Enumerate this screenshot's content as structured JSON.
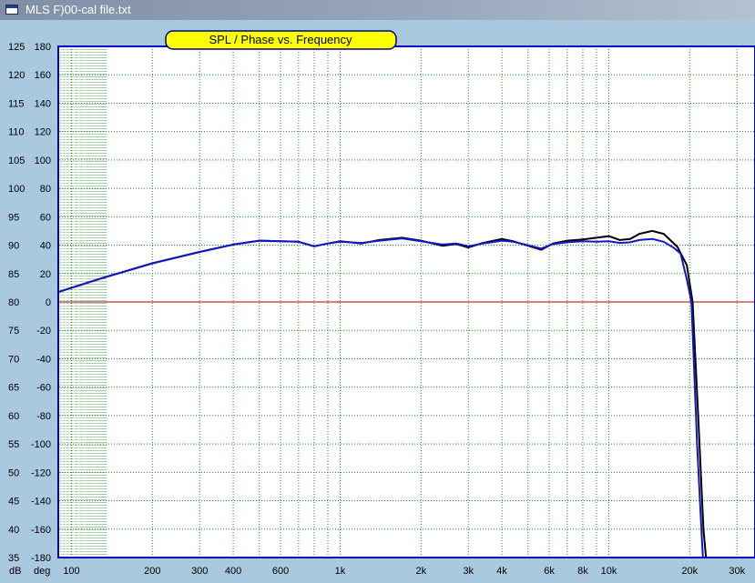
{
  "window": {
    "title": "MLS F)00-cal file.txt"
  },
  "colors": {
    "grid": "#1f8a2a",
    "zero_line": "#b00000",
    "spl_curve": "#000000",
    "phase_curve": "#1414c8",
    "background": "#a9c9de",
    "title_box": "#ffff00"
  },
  "chart_data": {
    "type": "line",
    "title": "SPL / Phase vs. Frequency",
    "x_scale": "log",
    "xlim": [
      90,
      35000
    ],
    "x_ticks": [
      {
        "value": 100,
        "label": "100"
      },
      {
        "value": 200,
        "label": "200"
      },
      {
        "value": 300,
        "label": "300"
      },
      {
        "value": 400,
        "label": "400"
      },
      {
        "value": 600,
        "label": "600"
      },
      {
        "value": 1000,
        "label": "1k"
      },
      {
        "value": 2000,
        "label": "2k"
      },
      {
        "value": 3000,
        "label": "3k"
      },
      {
        "value": 4000,
        "label": "4k"
      },
      {
        "value": 6000,
        "label": "6k"
      },
      {
        "value": 8000,
        "label": "8k"
      },
      {
        "value": 10000,
        "label": "10k"
      },
      {
        "value": 20000,
        "label": "20k"
      },
      {
        "value": 30000,
        "label": "30k"
      }
    ],
    "y_spl": {
      "unit": "dB",
      "range": [
        35,
        125
      ],
      "ticks": [
        125,
        120,
        115,
        110,
        105,
        100,
        95,
        90,
        85,
        80,
        75,
        70,
        65,
        60,
        55,
        50,
        45,
        40,
        35
      ]
    },
    "y_phase": {
      "unit": "deg",
      "range": [
        -180,
        180
      ],
      "ticks": [
        180,
        160,
        140,
        120,
        100,
        80,
        60,
        40,
        20,
        0,
        -20,
        -40,
        -60,
        -80,
        -100,
        -120,
        -140,
        -160,
        -180
      ]
    },
    "grid": true,
    "series": [
      {
        "color": "#000000",
        "axis": "spl",
        "points": [
          [
            90,
            81.8
          ],
          [
            100,
            82.5
          ],
          [
            130,
            84.2
          ],
          [
            200,
            86.8
          ],
          [
            300,
            88.8
          ],
          [
            400,
            90.1
          ],
          [
            500,
            90.8
          ],
          [
            700,
            90.6
          ],
          [
            800,
            89.8
          ],
          [
            900,
            90.3
          ],
          [
            1000,
            90.7
          ],
          [
            1200,
            90.3
          ],
          [
            1400,
            90.9
          ],
          [
            1700,
            91.3
          ],
          [
            2000,
            90.8
          ],
          [
            2400,
            89.9
          ],
          [
            2700,
            90.2
          ],
          [
            3000,
            89.6
          ],
          [
            3400,
            90.4
          ],
          [
            4000,
            91.1
          ],
          [
            4400,
            90.7
          ],
          [
            5000,
            89.9
          ],
          [
            5600,
            89.2
          ],
          [
            6200,
            90.3
          ],
          [
            7000,
            90.8
          ],
          [
            8000,
            91.0
          ],
          [
            9000,
            91.3
          ],
          [
            10000,
            91.6
          ],
          [
            11000,
            90.9
          ],
          [
            12000,
            91.1
          ],
          [
            13000,
            92.0
          ],
          [
            14500,
            92.5
          ],
          [
            16000,
            92.0
          ],
          [
            18000,
            89.7
          ],
          [
            19500,
            86.5
          ],
          [
            20500,
            80
          ],
          [
            21500,
            60
          ],
          [
            22500,
            40
          ],
          [
            23000,
            35
          ]
        ]
      },
      {
        "color": "#1414c8",
        "axis": "spl",
        "points": [
          [
            90,
            81.8
          ],
          [
            100,
            82.5
          ],
          [
            130,
            84.2
          ],
          [
            200,
            86.8
          ],
          [
            300,
            88.8
          ],
          [
            400,
            90.1
          ],
          [
            500,
            90.8
          ],
          [
            700,
            90.6
          ],
          [
            800,
            89.8
          ],
          [
            900,
            90.3
          ],
          [
            1000,
            90.6
          ],
          [
            1200,
            90.4
          ],
          [
            1400,
            90.8
          ],
          [
            1700,
            91.2
          ],
          [
            2000,
            90.7
          ],
          [
            2400,
            90.1
          ],
          [
            2700,
            90.3
          ],
          [
            3000,
            89.8
          ],
          [
            3400,
            90.3
          ],
          [
            4000,
            90.8
          ],
          [
            4400,
            90.6
          ],
          [
            5000,
            90.0
          ],
          [
            5600,
            89.4
          ],
          [
            6200,
            90.2
          ],
          [
            7000,
            90.5
          ],
          [
            8000,
            90.7
          ],
          [
            9000,
            90.6
          ],
          [
            10000,
            90.7
          ],
          [
            11000,
            90.4
          ],
          [
            12000,
            90.5
          ],
          [
            13000,
            90.9
          ],
          [
            14500,
            91.1
          ],
          [
            16000,
            90.6
          ],
          [
            17500,
            89.5
          ],
          [
            18500,
            88.5
          ],
          [
            19500,
            84
          ],
          [
            20300,
            80
          ],
          [
            20700,
            70
          ],
          [
            21300,
            55
          ],
          [
            22000,
            42
          ],
          [
            22400,
            35
          ]
        ]
      }
    ]
  }
}
